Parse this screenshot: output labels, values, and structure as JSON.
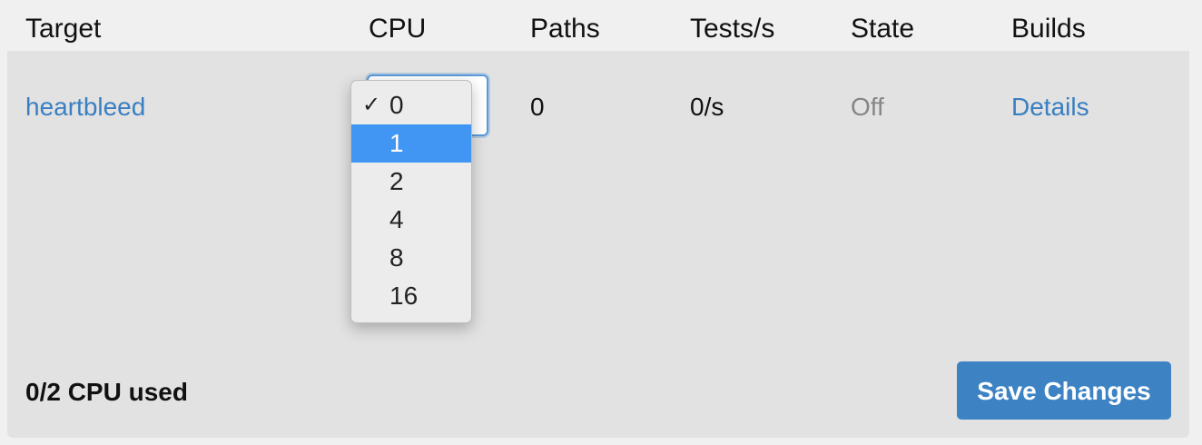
{
  "columns": {
    "target": "Target",
    "cpu": "CPU",
    "paths": "Paths",
    "tests": "Tests/s",
    "state": "State",
    "builds": "Builds"
  },
  "row": {
    "target": "heartbleed",
    "paths": "0",
    "tests": "0/s",
    "state": "Off",
    "builds": "Details"
  },
  "cpu_select": {
    "selected": "0",
    "highlighted": "1",
    "options": [
      "0",
      "1",
      "2",
      "4",
      "8",
      "16"
    ],
    "check_mark": "✓"
  },
  "footer": {
    "usage": "0/2 CPU used",
    "save_label": "Save Changes"
  },
  "colors": {
    "link": "#3a7fc1",
    "highlight": "#4196f4",
    "button": "#3d83c4"
  }
}
